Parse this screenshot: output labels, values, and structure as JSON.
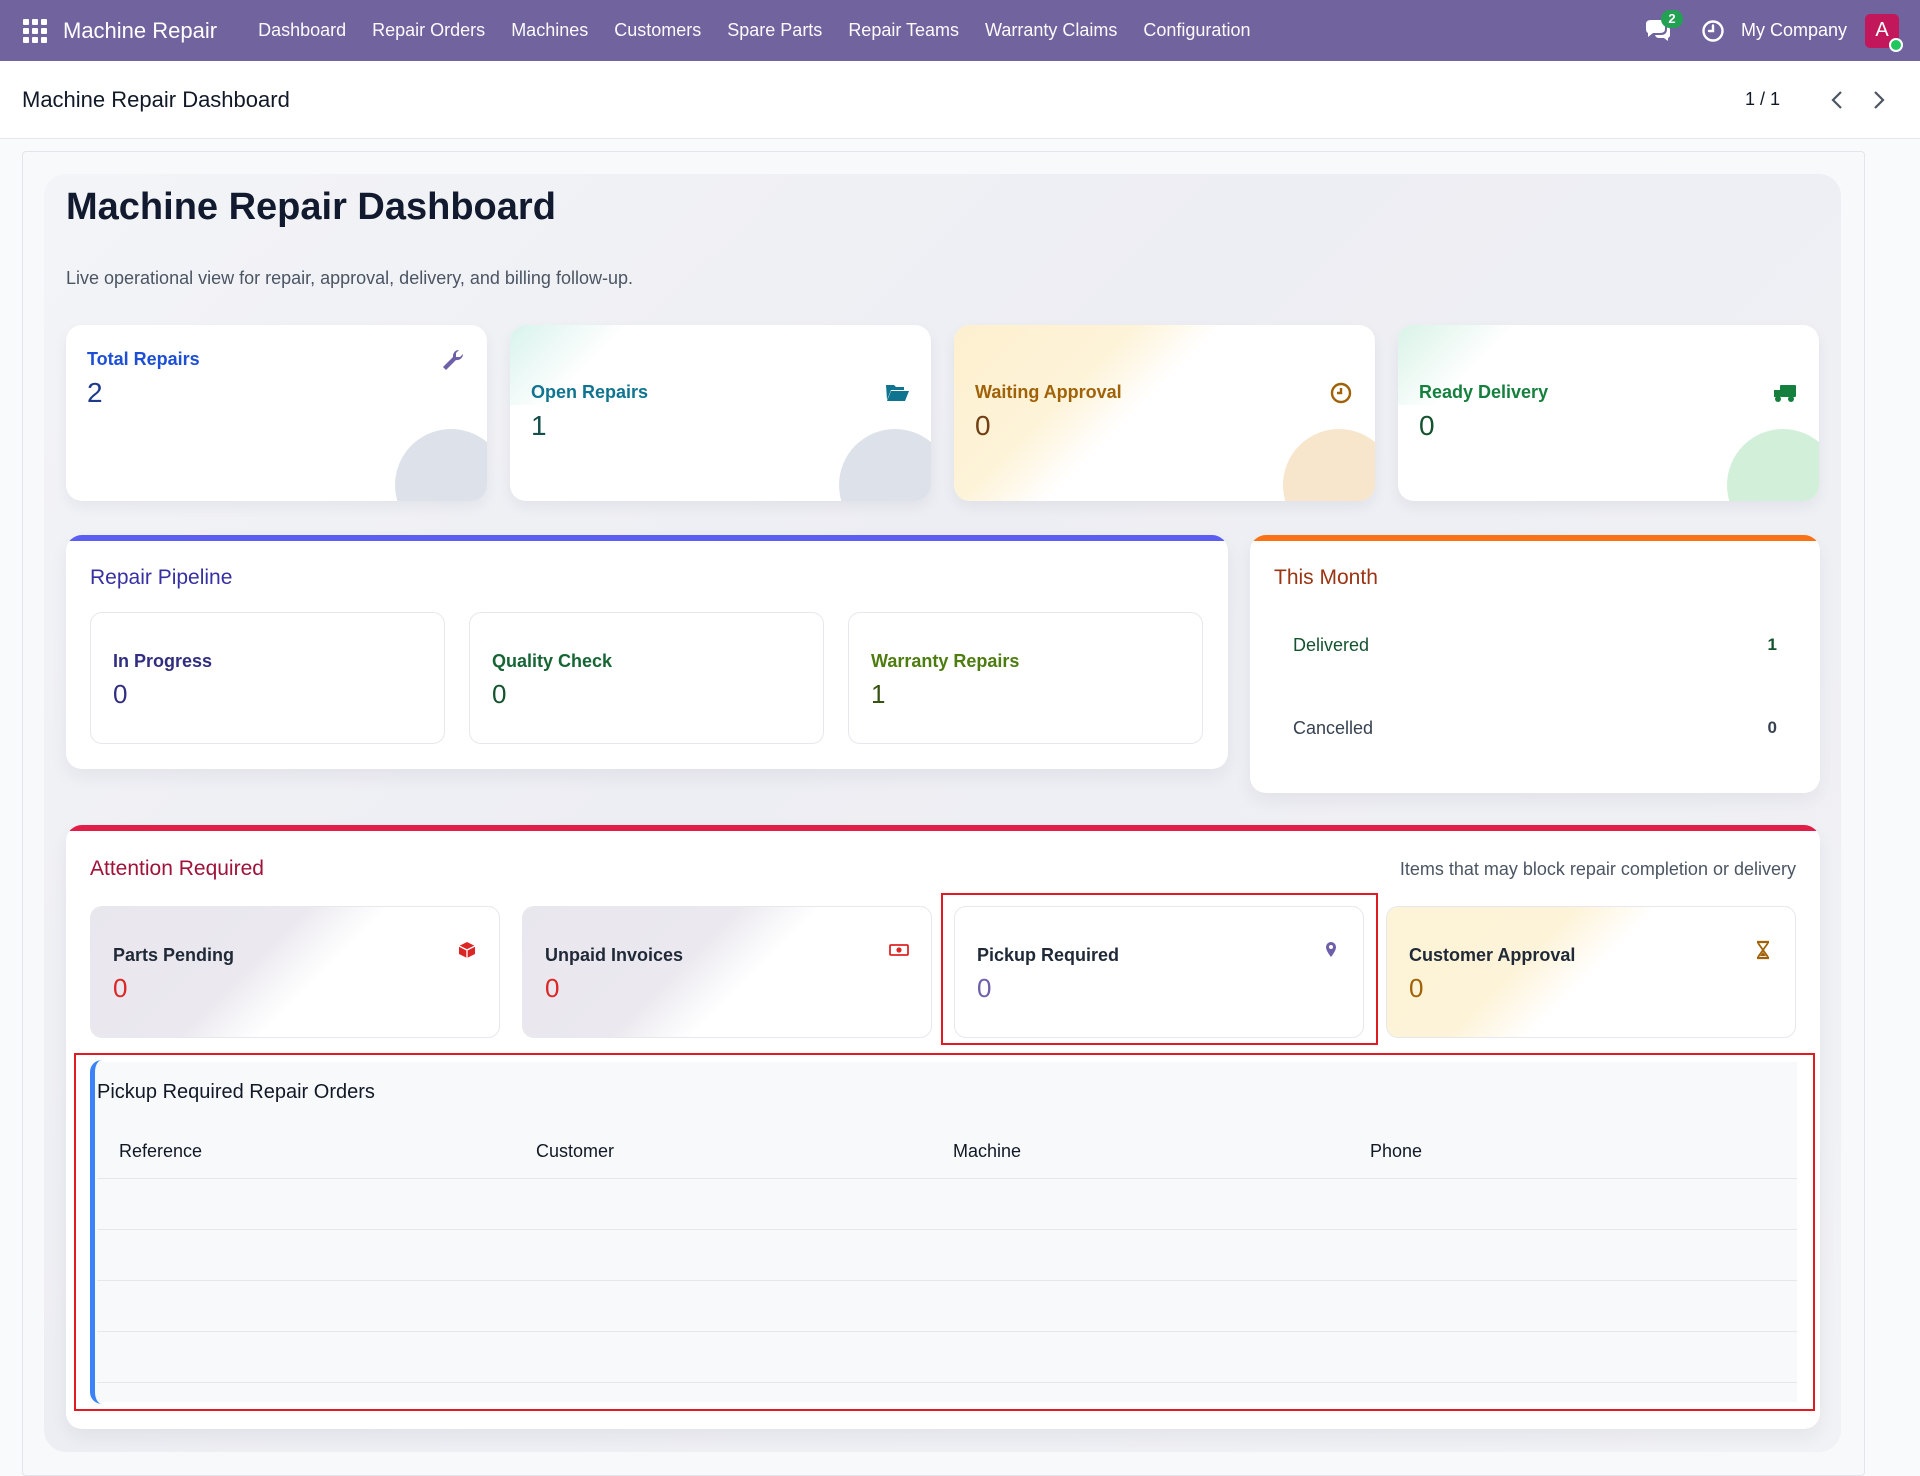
{
  "navbar": {
    "brand": "Machine Repair",
    "menu": [
      "Dashboard",
      "Repair Orders",
      "Machines",
      "Customers",
      "Spare Parts",
      "Repair Teams",
      "Warranty Claims",
      "Configuration"
    ],
    "chat_count": "2",
    "company": "My Company",
    "avatar_letter": "A",
    "colors": {
      "bar": "#71639e",
      "badge": "#22a152",
      "avatar": "#c2185b"
    }
  },
  "control_panel": {
    "breadcrumb": "Machine Repair Dashboard",
    "pager": "1 / 1"
  },
  "dashboard": {
    "title": "Machine Repair Dashboard",
    "subtitle": "Live operational view for repair, approval, delivery, and billing follow-up.",
    "kpis": [
      {
        "label": "Total Repairs",
        "value": "2",
        "icon": "wrench-icon",
        "color": "#1d4ed8"
      },
      {
        "label": "Open Repairs",
        "value": "1",
        "icon": "folder-open-icon",
        "color": "#0f7490"
      },
      {
        "label": "Waiting Approval",
        "value": "0",
        "icon": "clock-icon",
        "color": "#a16207"
      },
      {
        "label": "Ready Delivery",
        "value": "0",
        "icon": "truck-icon",
        "color": "#15803d"
      }
    ],
    "pipeline": {
      "title": "Repair Pipeline",
      "cards": [
        {
          "label": "In Progress",
          "value": "0",
          "color": "#312e81"
        },
        {
          "label": "Quality Check",
          "value": "0",
          "color": "#166534"
        },
        {
          "label": "Warranty Repairs",
          "value": "1",
          "color": "#4d7c0f"
        }
      ]
    },
    "this_month": {
      "title": "This Month",
      "rows": [
        {
          "label": "Delivered",
          "value": "1"
        },
        {
          "label": "Cancelled",
          "value": "0"
        }
      ]
    },
    "attention": {
      "title": "Attention Required",
      "hint": "Items that may block repair completion or delivery",
      "cards": [
        {
          "label": "Parts Pending",
          "value": "0",
          "icon": "box-icon",
          "color": "#dc2626"
        },
        {
          "label": "Unpaid Invoices",
          "value": "0",
          "icon": "money-icon",
          "color": "#dc2626"
        },
        {
          "label": "Pickup Required",
          "value": "0",
          "icon": "map-pin-icon",
          "color": "#6d5fa8"
        },
        {
          "label": "Customer Approval",
          "value": "0",
          "icon": "hourglass-icon",
          "color": "#a16207"
        }
      ]
    },
    "pickup_table": {
      "title": "Pickup Required Repair Orders",
      "columns": [
        "Reference",
        "Customer",
        "Machine",
        "Phone"
      ],
      "rows": []
    }
  }
}
